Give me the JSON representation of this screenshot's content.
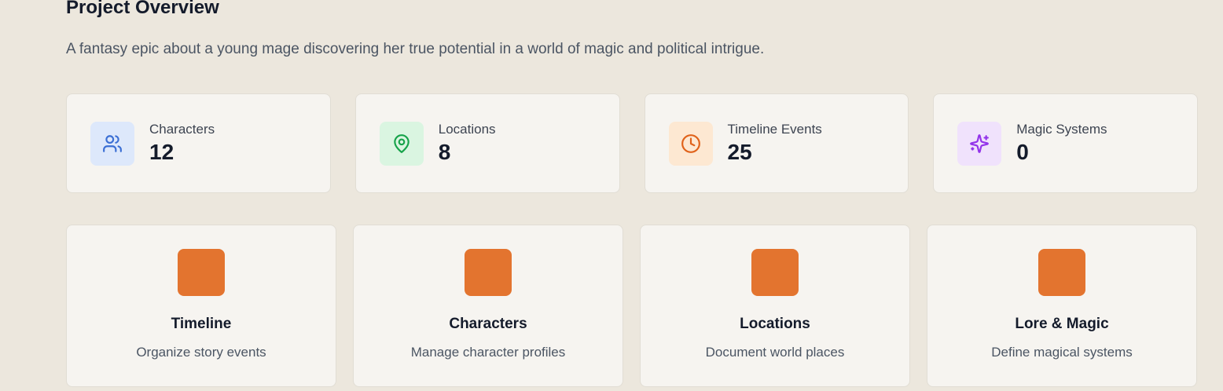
{
  "overview": {
    "title": "Project Overview",
    "description": "A fantasy epic about a young mage discovering her true potential in a world of magic and political intrigue."
  },
  "stats": [
    {
      "label": "Characters",
      "value": "12",
      "icon": "users-icon",
      "icon_color": "#3b6fd4",
      "icon_bg": "#dde8fb"
    },
    {
      "label": "Locations",
      "value": "8",
      "icon": "map-pin-icon",
      "icon_color": "#16a34a",
      "icon_bg": "#daf5e1"
    },
    {
      "label": "Timeline Events",
      "value": "25",
      "icon": "clock-icon",
      "icon_color": "#e0621a",
      "icon_bg": "#fde8d2"
    },
    {
      "label": "Magic Systems",
      "value": "0",
      "icon": "sparkles-icon",
      "icon_color": "#9333ea",
      "icon_bg": "#f0e2fc"
    }
  ],
  "features": [
    {
      "title": "Timeline",
      "description": "Organize story events",
      "swatch_color": "#e3742f"
    },
    {
      "title": "Characters",
      "description": "Manage character profiles",
      "swatch_color": "#e3742f"
    },
    {
      "title": "Locations",
      "description": "Document world places",
      "swatch_color": "#e3742f"
    },
    {
      "title": "Lore & Magic",
      "description": "Define magical systems",
      "swatch_color": "#e3742f"
    }
  ],
  "colors": {
    "background": "#ece7dd",
    "card": "#f6f4f0",
    "accent": "#e3742f"
  }
}
